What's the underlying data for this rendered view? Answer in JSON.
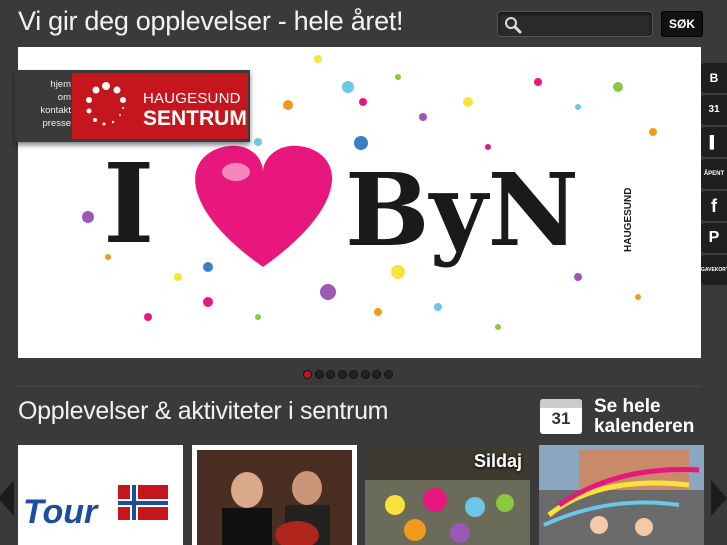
{
  "header": {
    "tagline": "Vi gir deg opplevelser - hele året!",
    "search_placeholder": "",
    "search_button": "SØK"
  },
  "hero": {
    "slogan_i": "I",
    "slogan_byen": "ByN",
    "slogan_vertical": "HAUGESUND",
    "slide_count": 8,
    "active_slide": 1
  },
  "logo": {
    "links": [
      "hjem",
      "om",
      "kontakt",
      "presse"
    ],
    "name_line1": "HAUGESUND",
    "name_line2": "SENTRUM"
  },
  "side_icons": [
    {
      "icon": "shopping-bag-icon",
      "glyph": "B"
    },
    {
      "icon": "calendar-icon",
      "glyph": "31"
    },
    {
      "icon": "book-icon",
      "glyph": "▌"
    },
    {
      "icon": "open-sign-icon",
      "glyph": "ÅPENT"
    },
    {
      "icon": "facebook-icon",
      "glyph": "f"
    },
    {
      "icon": "parking-icon",
      "glyph": "P"
    },
    {
      "icon": "gift-card-icon",
      "glyph": "GAVEKORT"
    }
  ],
  "section": {
    "title": "Opplevelser & aktiviteter i sentrum",
    "calendar_day": "31",
    "calendar_line1": "Se hele",
    "calendar_line2": "kalenderen"
  },
  "cards": [
    {
      "label": "",
      "image": "tour-of-norway-logo"
    },
    {
      "label": "",
      "image": "guitar-concert-photo"
    },
    {
      "label": "Sildaj",
      "image": "festival-parade-photo"
    },
    {
      "label": "",
      "image": "street-carnival-photo"
    }
  ],
  "colors": {
    "background": "#3a3a3a",
    "brand_red": "#c4161c",
    "heart_pink": "#e8177e"
  }
}
